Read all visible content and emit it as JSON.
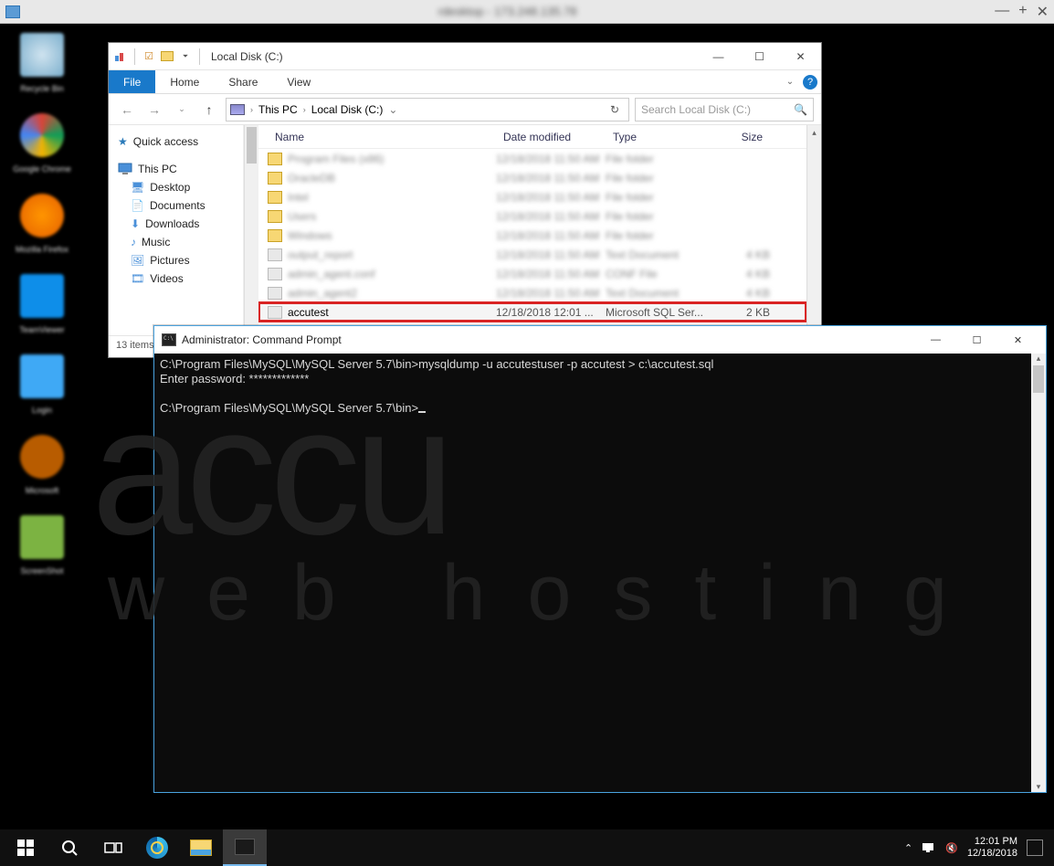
{
  "rdesktop": {
    "title": "rdesktop - 173.248.135.78"
  },
  "desktop_icons": [
    {
      "name": "Recycle Bin",
      "color": "#7aaecc"
    },
    {
      "name": "Google Chrome",
      "color": "#d85040"
    },
    {
      "name": "Mozilla Firefox",
      "color": "#e66000"
    },
    {
      "name": "TeamViewer",
      "color": "#0e8ee9"
    },
    {
      "name": "Login",
      "color": "#3fa9f5"
    },
    {
      "name": "Microsoft",
      "color": "#b85c00"
    },
    {
      "name": "ScreenShot",
      "color": "#7cb342"
    }
  ],
  "explorer": {
    "title": "Local Disk (C:)",
    "tabs": {
      "file": "File",
      "home": "Home",
      "share": "Share",
      "view": "View"
    },
    "breadcrumb": [
      "This PC",
      "Local Disk (C:)"
    ],
    "search_placeholder": "Search Local Disk (C:)",
    "columns": {
      "name": "Name",
      "date": "Date modified",
      "type": "Type",
      "size": "Size"
    },
    "nav": {
      "quick": "Quick access",
      "thispc": "This PC",
      "children": [
        "Desktop",
        "Documents",
        "Downloads",
        "Music",
        "Pictures",
        "Videos"
      ]
    },
    "rows_blur": [
      {
        "name": "Program Files (x86)",
        "type": "File folder"
      },
      {
        "name": "OracleDB",
        "type": "File folder"
      },
      {
        "name": "Intel",
        "type": "File folder"
      },
      {
        "name": "Users",
        "type": "File folder"
      },
      {
        "name": "Windows",
        "type": "File folder"
      },
      {
        "name": "output_report",
        "type": "Text Document",
        "icon": "file"
      },
      {
        "name": "admin_agent.conf",
        "type": "CONF File",
        "icon": "file"
      },
      {
        "name": "admin_agent2",
        "type": "Text Document",
        "icon": "file"
      }
    ],
    "highlight_row": {
      "name": "accutest",
      "date": "12/18/2018 12:01 ...",
      "type": "Microsoft SQL Ser...",
      "size": "2 KB"
    },
    "status": "13 items"
  },
  "cmd": {
    "title": "Administrator: Command Prompt",
    "line1": "C:\\Program Files\\MySQL\\MySQL Server 5.7\\bin>mysqldump -u accutestuser -p accutest > c:\\accutest.sql",
    "line2": "Enter password: *************",
    "line3": "",
    "line4": "C:\\Program Files\\MySQL\\MySQL Server 5.7\\bin>"
  },
  "watermark": {
    "brand": "accu",
    "tag": "web hosting"
  },
  "taskbar": {
    "time": "12:01 PM",
    "date": "12/18/2018"
  }
}
